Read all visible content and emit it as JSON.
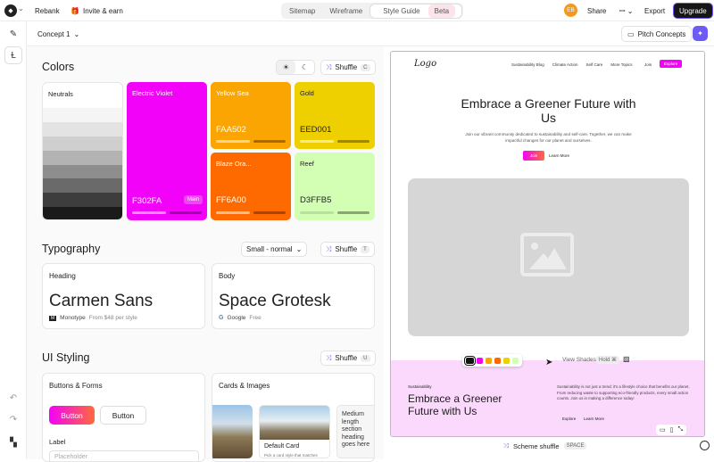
{
  "topbar": {
    "project_menu": "⌄",
    "rebank": "Rebank",
    "invite": "Invite & earn",
    "tabs": [
      "Sitemap",
      "Wireframe",
      "Style Guide"
    ],
    "beta": "Beta",
    "avatar": "EB",
    "share": "Share",
    "export": "Export",
    "upgrade": "Upgrade"
  },
  "toolbar": {
    "concept": "Concept 1",
    "pitch": "Pitch Concepts"
  },
  "colors": {
    "title": "Colors",
    "shuffle": "Shuffle",
    "shuffle_key": "C",
    "neutrals_label": "Neutrals",
    "neutral_shades": [
      "#f5f5f5",
      "#e3e3e3",
      "#cfcfcf",
      "#b3b3b3",
      "#8e8e8e",
      "#6a6a6a",
      "#3d3d3d",
      "#1a1a1a"
    ],
    "swatches": [
      {
        "name": "Electric Violet",
        "hex": "F302FA",
        "badge": "Main",
        "color": "#f302fa",
        "text": "#fff"
      },
      {
        "name": "Yellow Sea",
        "hex": "FAA502",
        "color": "#faa502",
        "text": "#fff"
      },
      {
        "name": "Gold",
        "hex": "EED001",
        "color": "#eed001",
        "text": "#222"
      },
      {
        "name": "Blaze Ora...",
        "hex": "FF6A00",
        "color": "#ff6a00",
        "text": "#fff"
      },
      {
        "name": "Reef",
        "hex": "D3FFB5",
        "color": "#d3ffb5",
        "text": "#222"
      }
    ]
  },
  "typography": {
    "title": "Typography",
    "size_select": "Small - normal",
    "shuffle": "Shuffle",
    "shuffle_key": "T",
    "heading": {
      "label": "Heading",
      "font": "Carmen Sans",
      "foundry": "Monotype",
      "price": "From $48 per style"
    },
    "body": {
      "label": "Body",
      "font": "Space Grotesk",
      "foundry": "Google",
      "price": "Free"
    }
  },
  "ui_styling": {
    "title": "UI Styling",
    "shuffle": "Shuffle",
    "shuffle_key": "U",
    "buttons": {
      "title": "Buttons & Forms",
      "primary": "Button",
      "secondary": "Button",
      "label": "Label",
      "placeholder": "Placeholder"
    },
    "cards": {
      "title": "Cards & Images",
      "card_title": "Default Card",
      "card_desc": "Pick a card style that matches",
      "medium_text": "Medium length section heading goes here"
    }
  },
  "preview": {
    "logo": "Logo",
    "nav": [
      "Sustainability Blog",
      "Climate Action",
      "Self Care",
      "More Topics"
    ],
    "join": "Join",
    "explore": "Explore",
    "hero_title": "Embrace a Greener Future with Us",
    "hero_text": "Join our vibrant community dedicated to sustainability and self-care. Together, we can make impactful changes for our planet and ourselves.",
    "hero_cta": "Join",
    "hero_link": "Learn More",
    "eyebrow": "Sustainability",
    "section_title": "Embrace a Greener Future with Us",
    "section_text": "Sustainability is not just a trend; it's a lifestyle choice that benefits our planet. From reducing waste to supporting eco-friendly products, every small action counts. Join us in making a difference today!",
    "section_cta": "Explore",
    "section_link": "Learn More",
    "view_shades": "View Shades",
    "hold": "Hold ⌘",
    "scheme_shuffle": "Scheme shuffle",
    "space": "SPACE"
  }
}
